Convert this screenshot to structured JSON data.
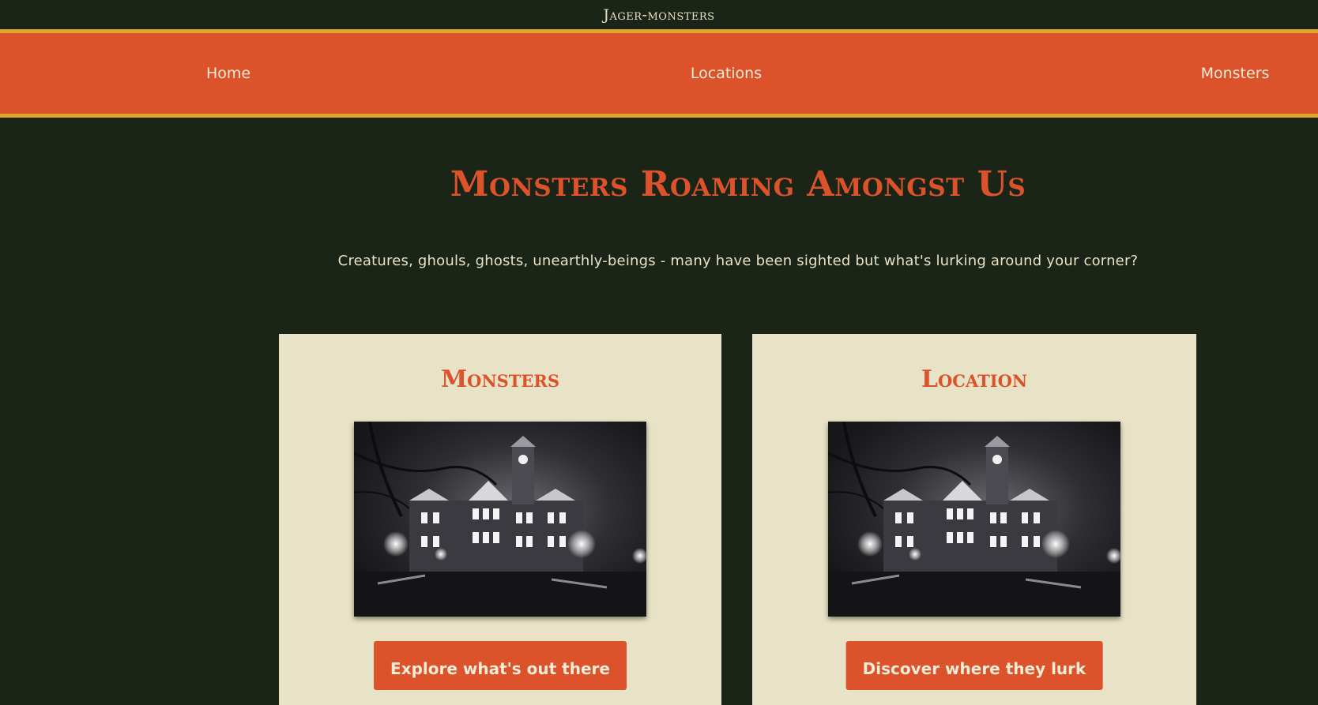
{
  "header": {
    "brand": "Jager-monsters"
  },
  "nav": {
    "home": "Home",
    "locations": "Locations",
    "monsters": "Monsters"
  },
  "hero": {
    "title": "Monsters Roaming Amongst Us",
    "subtitle": "Creatures, ghouls, ghosts, unearthly-beings - many have been sighted but what's lurking around your corner?"
  },
  "cards": [
    {
      "title": "Monsters",
      "button": "Explore what's out there",
      "image_icon": "haunted-building-photo"
    },
    {
      "title": "Location",
      "button": "Discover where they lurk",
      "image_icon": "haunted-building-photo"
    }
  ],
  "colors": {
    "background": "#1a2518",
    "accent": "#dc522b",
    "gold": "#e0a528",
    "card": "#e8e3c6",
    "text_light": "#e8e2c6"
  }
}
